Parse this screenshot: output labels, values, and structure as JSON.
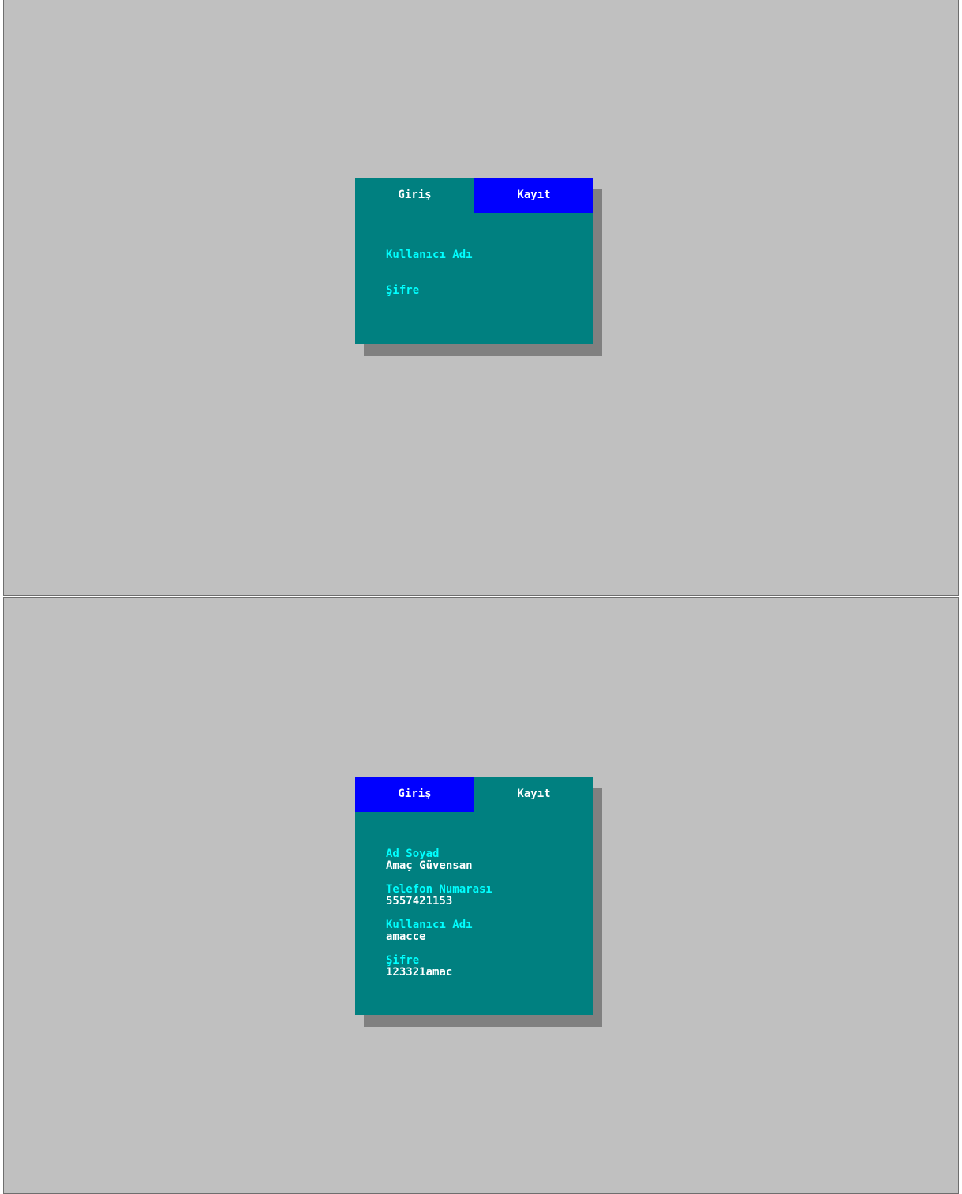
{
  "login_screen": {
    "tabs": [
      {
        "label": "Giriş",
        "active": true
      },
      {
        "label": "Kayıt",
        "active": false
      }
    ],
    "fields": [
      {
        "label": "Kullanıcı Adı",
        "value": ""
      },
      {
        "label": "Şifre",
        "value": ""
      }
    ]
  },
  "register_screen": {
    "tabs": [
      {
        "label": "Giriş",
        "active": false
      },
      {
        "label": "Kayıt",
        "active": true
      }
    ],
    "fields": [
      {
        "label": "Ad Soyad",
        "value": "Amaç Güvensan"
      },
      {
        "label": "Telefon Numarası",
        "value": "5557421153"
      },
      {
        "label": "Kullanıcı Adı",
        "value": "amacce"
      },
      {
        "label": "Şifre",
        "value": "123321amac"
      }
    ]
  },
  "colors": {
    "desktop": "#c0c0c0",
    "dialog": "#008080",
    "inactive_tab": "#0000ff",
    "label": "#00ffff",
    "value": "#ffffff",
    "shadow": "#808080"
  }
}
